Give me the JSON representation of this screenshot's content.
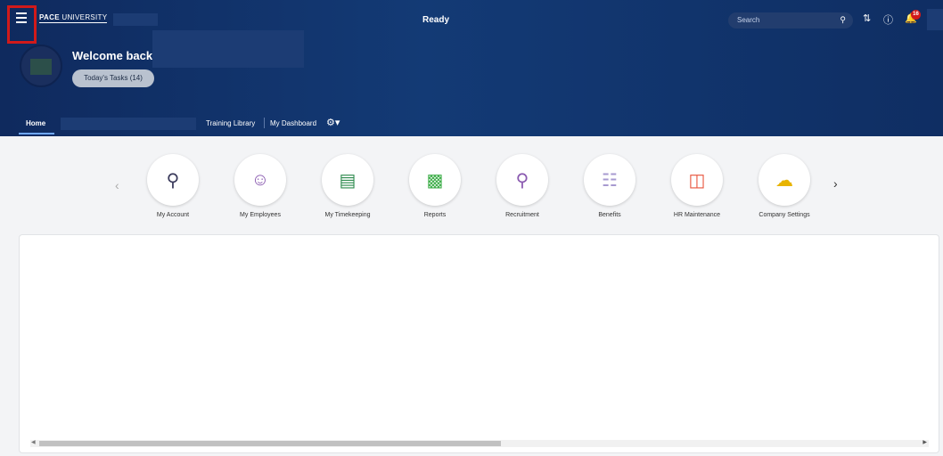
{
  "header": {
    "logo_bold": "PACE",
    "logo_rest": " UNIVERSITY",
    "app_title": "Ready",
    "search_placeholder": "Search",
    "notification_count": "16",
    "welcome": "Welcome back,",
    "tasks_button": "Today's Tasks (14)"
  },
  "tabs": [
    {
      "label": "Home"
    },
    {
      "label": "Training Library"
    },
    {
      "label": "My Dashboard"
    }
  ],
  "tiles": [
    {
      "label": "My Account",
      "icon": "account-search-icon",
      "color": "#3b3b5c"
    },
    {
      "label": "My Employees",
      "icon": "employees-icon",
      "color": "#8a5ab0"
    },
    {
      "label": "My Timekeeping",
      "icon": "timekeeping-icon",
      "color": "#2e8b4e"
    },
    {
      "label": "Reports",
      "icon": "reports-chart-icon",
      "color": "#3fae4a"
    },
    {
      "label": "Recruitment",
      "icon": "recruitment-icon",
      "color": "#8a5ab0"
    },
    {
      "label": "Benefits",
      "icon": "benefits-icon",
      "color": "#a79ad0"
    },
    {
      "label": "HR Maintenance",
      "icon": "gift-icon",
      "color": "#e8553d"
    },
    {
      "label": "Company Settings",
      "icon": "company-settings-icon",
      "color": "#e8b400"
    }
  ],
  "colors": {
    "header_bg": "#133a75",
    "accent_red": "#d11a1a"
  }
}
